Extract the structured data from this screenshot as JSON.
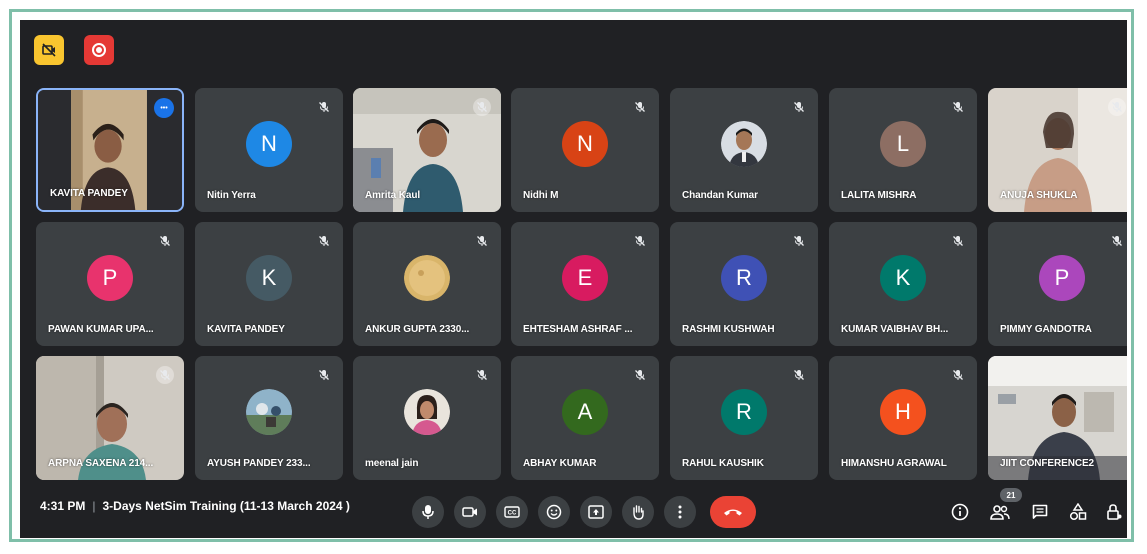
{
  "meeting": {
    "time": "4:31 PM",
    "separator": "|",
    "title": "3-Days NetSim Training (11-13 March 2024 )",
    "participant_count": "21"
  },
  "colors": {
    "background": "#202124",
    "tile": "#3c4043",
    "end_call": "#ea4335",
    "active_border": "#8ab4f8",
    "frame": "#7fbfa9"
  },
  "participants": [
    {
      "name": "KAVITA PANDEY",
      "type": "video",
      "muted": false,
      "active": true
    },
    {
      "name": "Nitin Yerra",
      "type": "initial",
      "initial": "N",
      "color": "#1e88e5",
      "muted": true
    },
    {
      "name": "Amrita Kaul",
      "type": "video",
      "muted": true
    },
    {
      "name": "Nidhi M",
      "type": "initial",
      "initial": "N",
      "color": "#d84315",
      "muted": true
    },
    {
      "name": "Chandan Kumar",
      "type": "photo",
      "muted": true
    },
    {
      "name": "LALITA MISHRA",
      "type": "initial",
      "initial": "L",
      "color": "#8d6e63",
      "muted": true
    },
    {
      "name": "ANUJA SHUKLA",
      "type": "video",
      "muted": true
    },
    {
      "name": "PAWAN KUMAR UPA...",
      "type": "initial",
      "initial": "P",
      "color": "#e8336d",
      "muted": true
    },
    {
      "name": "KAVITA PANDEY",
      "type": "initial",
      "initial": "K",
      "color": "#455a64",
      "muted": true
    },
    {
      "name": "ANKUR GUPTA 2330...",
      "type": "photo",
      "muted": true
    },
    {
      "name": "EHTESHAM ASHRAF ...",
      "type": "initial",
      "initial": "E",
      "color": "#d81b60",
      "muted": true
    },
    {
      "name": "RASHMI KUSHWAH",
      "type": "initial",
      "initial": "R",
      "color": "#3f51b5",
      "muted": true
    },
    {
      "name": "KUMAR VAIBHAV BH...",
      "type": "initial",
      "initial": "K",
      "color": "#00796b",
      "muted": true
    },
    {
      "name": "PIMMY GANDOTRA",
      "type": "initial",
      "initial": "P",
      "color": "#ab47bc",
      "muted": true
    },
    {
      "name": "ARPNA SAXENA 214...",
      "type": "video",
      "muted": true
    },
    {
      "name": "AYUSH PANDEY 233...",
      "type": "photo",
      "muted": true
    },
    {
      "name": "meenal jain",
      "type": "photo",
      "muted": true
    },
    {
      "name": "ABHAY KUMAR",
      "type": "initial",
      "initial": "A",
      "color": "#33691e",
      "muted": true
    },
    {
      "name": "RAHUL KAUSHIK",
      "type": "initial",
      "initial": "R",
      "color": "#00796b",
      "muted": true
    },
    {
      "name": "HIMANSHU AGRAWAL",
      "type": "initial",
      "initial": "H",
      "color": "#f4511e",
      "muted": true
    },
    {
      "name": "JIIT CONFERENCE2",
      "type": "video",
      "muted": false
    }
  ],
  "controls": {
    "center": [
      {
        "name": "microphone-button",
        "icon": "microphone-icon"
      },
      {
        "name": "camera-button",
        "icon": "camera-icon"
      },
      {
        "name": "captions-button",
        "icon": "captions-icon"
      },
      {
        "name": "emoji-button",
        "icon": "emoji-icon"
      },
      {
        "name": "present-button",
        "icon": "present-icon"
      },
      {
        "name": "raise-hand-button",
        "icon": "hand-icon"
      },
      {
        "name": "more-options-button",
        "icon": "more-vert-icon"
      },
      {
        "name": "leave-call-button",
        "icon": "phone-end-icon"
      }
    ],
    "right": [
      {
        "name": "meeting-details-button",
        "icon": "info-icon"
      },
      {
        "name": "people-button",
        "icon": "people-icon"
      },
      {
        "name": "chat-button",
        "icon": "chat-icon"
      },
      {
        "name": "activities-button",
        "icon": "shapes-icon"
      },
      {
        "name": "host-controls-button",
        "icon": "lock-person-icon"
      }
    ]
  }
}
